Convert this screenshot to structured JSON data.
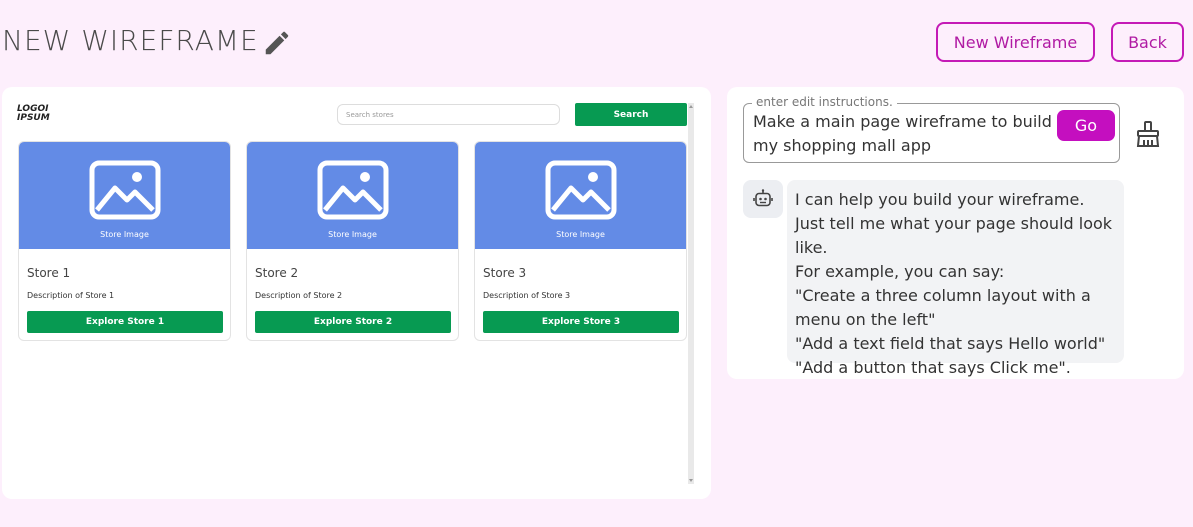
{
  "header": {
    "title": "NEW WIREFRAME",
    "new_wireframe_label": "New Wireframe",
    "back_label": "Back"
  },
  "preview": {
    "logo_line1": "LOGOI",
    "logo_line2": "IPSUM",
    "search_placeholder": "Search stores",
    "search_button": "Search",
    "image_label": "Store Image",
    "cards": [
      {
        "title": "Store 1",
        "description": "Description of Store 1",
        "button": "Explore Store 1"
      },
      {
        "title": "Store 2",
        "description": "Description of Store 2",
        "button": "Explore Store 2"
      },
      {
        "title": "Store 3",
        "description": "Description of Store 3",
        "button": "Explore Store 3"
      }
    ]
  },
  "chat": {
    "input_legend": "enter edit instructions.",
    "input_value": "Make a main page wireframe to build my shopping mall app",
    "go_label": "Go",
    "bot_message_lines": [
      "I can help you build your wireframe. Just tell me what your page should look like.",
      "For example, you can say:",
      "\"Create a three column layout with a menu on the left\"",
      "\"Add a text field that says Hello world\"",
      "\"Add a button that says Click me\"."
    ]
  },
  "colors": {
    "background": "#fdeffc",
    "accent": "#c40fbf",
    "green": "#079a52",
    "image_blue": "#638be6"
  },
  "icons": {
    "edit": "pencil-icon",
    "clear": "broom-icon",
    "bot": "robot-icon",
    "image": "image-placeholder-icon"
  }
}
